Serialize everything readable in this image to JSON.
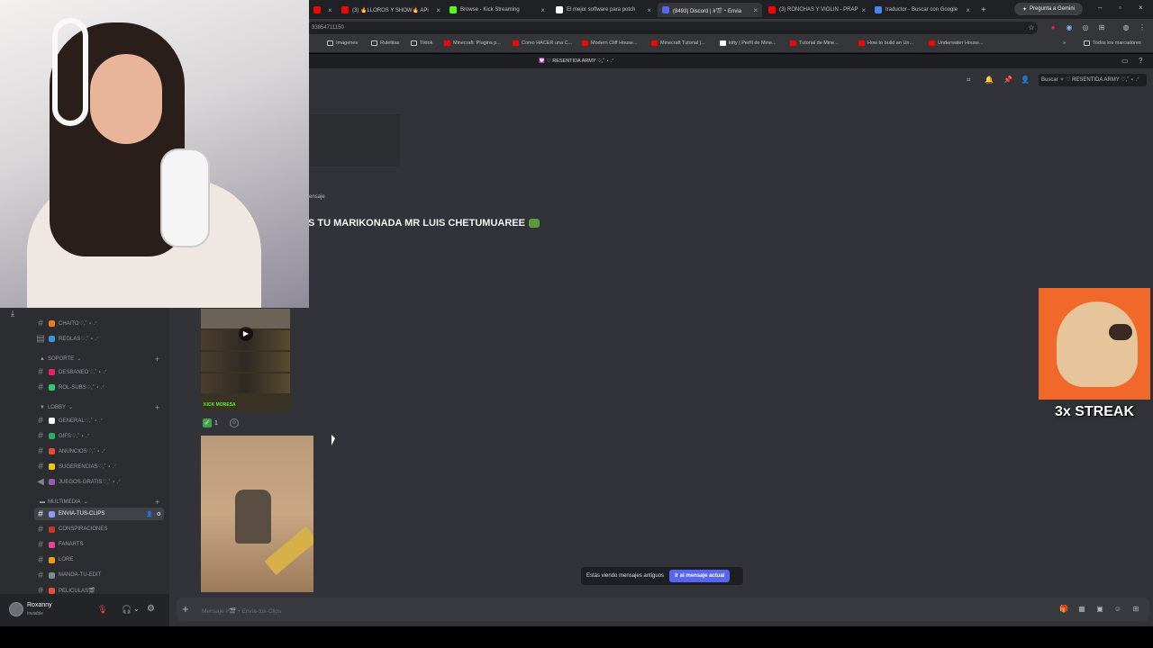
{
  "browser": {
    "tabs": [
      {
        "label": "",
        "color": "#ff0000"
      },
      {
        "label": "(3) 🔥LLOROS Y SHOW🔥 APi",
        "color": "#ff0000"
      },
      {
        "label": "Browse - Kick Streaming",
        "color": "#53fc18"
      },
      {
        "label": "El mejor software para potch",
        "color": "#ffffff"
      },
      {
        "label": "(8493) Discord | #🎬・Envia",
        "color": "#5865f2"
      },
      {
        "label": "(3) RONCHAS Y VIOLIN - PRAP",
        "color": "#ff0000"
      },
      {
        "label": "traductor - Buscar con Google",
        "color": "#4285f4"
      }
    ],
    "gemini_label": "Pregunta a Gemini",
    "url": "33854711150",
    "bookmarks": [
      {
        "label": "Imagenes",
        "color": "#bdc1c6"
      },
      {
        "label": "Ruletitas",
        "color": "#bdc1c6"
      },
      {
        "label": "Tiktok",
        "color": "#bdc1c6"
      },
      {
        "label": "Minecraft: Plugins p...",
        "color": "#ff0000"
      },
      {
        "label": "Como HACER una C...",
        "color": "#ff0000"
      },
      {
        "label": "Modern Cliff House...",
        "color": "#ff0000"
      },
      {
        "label": "Minecraft Tutorial |...",
        "color": "#ff0000"
      },
      {
        "label": "kitty | Perfil de Mine...",
        "color": "#ffffff"
      },
      {
        "label": "Tutorial de Mine...",
        "color": "#ff0000"
      },
      {
        "label": "How to build an Un...",
        "color": "#ff0000"
      },
      {
        "label": "Underwater House...",
        "color": "#ff0000"
      }
    ],
    "all_bookmarks": "Todos los marcadores"
  },
  "discord": {
    "server_title": "💟 ♡ RESENTIDA ARMY ♡,˚ ⋆ .ᐟ",
    "search_placeholder": "Buscar ✧ ♡ RESENTIDA ARMY ♡,˚ ⋆ .ᐟ",
    "categories": [
      {
        "label": "SOPORTE"
      },
      {
        "label": "LOBBY"
      },
      {
        "label": "MULTIMEDIA"
      }
    ],
    "channels": [
      {
        "label": "CHAITO♡,˚ ⋆ .ᐟ",
        "color": "#e67e22"
      },
      {
        "label": "REGLAS♡,˚ ⋆ .ᐟ",
        "color": "#3498db"
      },
      {
        "label": "DESBANEO♡,˚ ⋆ .ᐟ",
        "color": "#e91e63"
      },
      {
        "label": "ROL-SUBS♡,˚ ⋆ .ᐟ",
        "color": "#2ecc71"
      },
      {
        "label": "GENERAL♡,˚ ⋆ .ᐟ",
        "color": "#ffffff"
      },
      {
        "label": "GIFS♡,˚ ⋆ .ᐟ",
        "color": "#27ae60"
      },
      {
        "label": "ANUNCIOS♡,˚ ⋆ .ᐟ",
        "color": "#e74c3c"
      },
      {
        "label": "SUGERENCIAS♡,˚ ⋆ .ᐟ",
        "color": "#f1c40f"
      },
      {
        "label": "JUEGOS-GRATIS♡,˚ ⋆ .ᐟ",
        "color": "#9b59b6"
      },
      {
        "label": "ENVIA-TUS-CLIPS",
        "color": "#8e9cf2"
      },
      {
        "label": "CONSPIRACIONES",
        "color": "#c0392b"
      },
      {
        "label": "FANARTS",
        "color": "#e84393"
      },
      {
        "label": "LORE",
        "color": "#f39c12"
      },
      {
        "label": "MANDA-TU-EDIT",
        "color": "#7f8c8d"
      },
      {
        "label": "PELICULAS🎬",
        "color": "#e74c3c"
      }
    ],
    "user": {
      "name": "Roxanny",
      "status": "Invisible"
    },
    "message": {
      "header": "ensaje",
      "text": "S TU MARIKONADA MR LUIS CHETUMUAREE"
    },
    "clip1_label": "KICK MORESA",
    "reaction": {
      "count": "1"
    },
    "old_messages": {
      "text": "Estás viendo mensajes antiguos",
      "button": "Ir al mensaje actual"
    },
    "composer_placeholder": "Mensaje #🎬・Envia-tus-Clips"
  },
  "overlay": {
    "streak_text": "3x STREAK"
  }
}
